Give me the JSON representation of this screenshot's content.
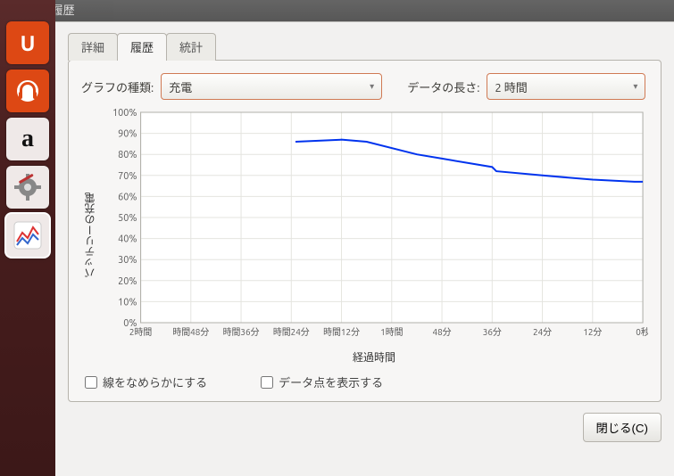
{
  "titlebar": "バイスの履歴",
  "launcher": {
    "items": [
      {
        "name": "ubuntu-software",
        "label": "U",
        "variant": "orange"
      },
      {
        "name": "ubuntu-one",
        "svg": "headset",
        "variant": "orange"
      },
      {
        "name": "amazon",
        "label": "a",
        "variant": "light",
        "style": "font-family:Georgia,serif;color:#111;font-size:28px"
      },
      {
        "name": "settings",
        "svg": "gear",
        "variant": "light"
      },
      {
        "name": "power-stats",
        "svg": "chart",
        "variant": "light",
        "active": true
      }
    ]
  },
  "tabs": {
    "detail": "詳細",
    "history": "履歴",
    "stats": "統計",
    "active": "history"
  },
  "controls": {
    "graph_type_label": "グラフの種類:",
    "graph_type_value": "充電",
    "data_length_label": "データの長さ:",
    "data_length_value": "2 時間"
  },
  "chart_data": {
    "type": "line",
    "title": "",
    "xlabel": "経過時間",
    "ylabel": "バッテリーの充電",
    "ylim": [
      0,
      100
    ],
    "y_ticks": [
      "100%",
      "90%",
      "80%",
      "70%",
      "60%",
      "50%",
      "40%",
      "30%",
      "20%",
      "10%",
      "0%"
    ],
    "x_ticks": [
      "2時間",
      "時間48分",
      "時間36分",
      "時間24分",
      "時間12分",
      "1時間",
      "48分",
      "36分",
      "24分",
      "12分",
      "0秒"
    ],
    "x_minutes": [
      120,
      108,
      96,
      84,
      72,
      60,
      48,
      36,
      24,
      12,
      0
    ],
    "series": [
      {
        "name": "充電",
        "color": "#0033ee",
        "points": [
          {
            "x_min": 83,
            "y": 86
          },
          {
            "x_min": 72,
            "y": 87
          },
          {
            "x_min": 66,
            "y": 86
          },
          {
            "x_min": 54,
            "y": 80
          },
          {
            "x_min": 48,
            "y": 78
          },
          {
            "x_min": 36,
            "y": 74
          },
          {
            "x_min": 35,
            "y": 72
          },
          {
            "x_min": 24,
            "y": 70
          },
          {
            "x_min": 12,
            "y": 68
          },
          {
            "x_min": 2,
            "y": 67
          },
          {
            "x_min": 0,
            "y": 67
          }
        ]
      }
    ]
  },
  "checks": {
    "smooth": "線をなめらかにする",
    "points": "データ点を表示する"
  },
  "footer": {
    "close": "閉じる(C)"
  }
}
